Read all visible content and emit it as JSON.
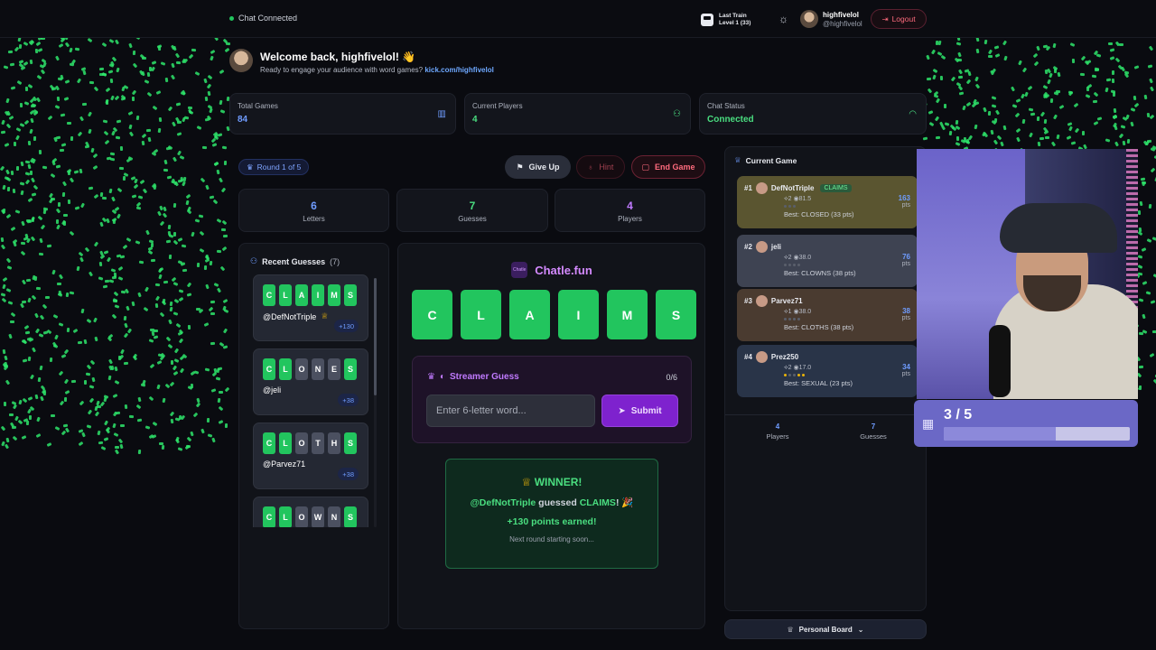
{
  "topbar": {
    "chat_status": "Chat Connected",
    "train_line1": "Last Train",
    "train_line2": "Level 1  (33)",
    "username": "highfivelol",
    "handle": "@highfivelol",
    "logout_label": "Logout"
  },
  "welcome": {
    "title": "Welcome back, highfivelol! 👋",
    "subtitle": "Ready to engage your audience with word games?",
    "link": "kick.com/highfivelol"
  },
  "stats": [
    {
      "label": "Total Games",
      "value": "84",
      "icon": "bar-chart-icon",
      "color": "#6f9cff"
    },
    {
      "label": "Current Players",
      "value": "4",
      "icon": "user-icon",
      "color": "#4ade80"
    },
    {
      "label": "Chat Status",
      "value": "Connected",
      "icon": "wifi-icon",
      "color": "#4ade80"
    }
  ],
  "game": {
    "round_label": "Round 1 of 5",
    "give_up_label": "Give Up",
    "hint_label": "Hint",
    "end_game_label": "End Game",
    "letters": {
      "value": "6",
      "label": "Letters"
    },
    "guesses": {
      "value": "7",
      "label": "Guesses"
    },
    "players": {
      "value": "4",
      "label": "Players"
    }
  },
  "recent_guesses": {
    "title": "Recent Guesses",
    "count": "(7)",
    "items": [
      {
        "letters": [
          "C",
          "L",
          "A",
          "I",
          "M",
          "S"
        ],
        "states": [
          "g",
          "g",
          "g",
          "g",
          "g",
          "g"
        ],
        "user": "@DefNotTriple",
        "trophy": true,
        "points": "+130"
      },
      {
        "letters": [
          "C",
          "L",
          "O",
          "N",
          "E",
          "S"
        ],
        "states": [
          "g",
          "g",
          "x",
          "x",
          "x",
          "g"
        ],
        "user": "@jeli",
        "trophy": false,
        "points": "+38"
      },
      {
        "letters": [
          "C",
          "L",
          "O",
          "T",
          "H",
          "S"
        ],
        "states": [
          "g",
          "g",
          "x",
          "x",
          "x",
          "g"
        ],
        "user": "@Parvez71",
        "trophy": false,
        "points": "+38"
      },
      {
        "letters": [
          "C",
          "L",
          "O",
          "W",
          "N",
          "S"
        ],
        "states": [
          "g",
          "g",
          "x",
          "x",
          "x",
          "g"
        ],
        "user": "",
        "trophy": false,
        "points": ""
      }
    ]
  },
  "board": {
    "logo_text": "Chatle",
    "brand": "Chatle.fun",
    "word": [
      "C",
      "L",
      "A",
      "I",
      "M",
      "S"
    ]
  },
  "streamer_guess": {
    "title": "Streamer Guess",
    "count": "0/6",
    "placeholder": "Enter 6-letter word...",
    "submit_label": "Submit"
  },
  "winner": {
    "title": "WINNER!",
    "user": "@DefNotTriple",
    "guessed_text": "guessed",
    "word": "CLAIMS",
    "suffix": "! 🎉",
    "points_text": "+130 points earned!",
    "next_text": "Next round starting soon..."
  },
  "current_game": {
    "title": "Current Game",
    "players": [
      {
        "rank": "#1",
        "name": "DefNotTriple",
        "badge": "CLAIMS",
        "sub": "⟡2 ◉81.5",
        "dots": [
          "g",
          "g",
          "g"
        ],
        "best": "Best: CLOSED (33 pts)",
        "points": "163",
        "pts_label": "pts",
        "bg": "#5a5530"
      },
      {
        "rank": "#2",
        "name": "jeli",
        "badge": "",
        "sub": "⟡2 ◉38.0",
        "dots": [
          "g",
          "g",
          "g",
          "g"
        ],
        "best": "Best: CLOWNS (38 pts)",
        "points": "76",
        "pts_label": "pts",
        "bg": "#3e4352"
      },
      {
        "rank": "#3",
        "name": "Parvez71",
        "badge": "",
        "sub": "⟡1 ◉38.0",
        "dots": [
          "g",
          "g",
          "g",
          "g"
        ],
        "best": "Best: CLOTHS (38 pts)",
        "points": "38",
        "pts_label": "pts",
        "bg": "#4a3b30"
      },
      {
        "rank": "#4",
        "name": "Prez250",
        "badge": "",
        "sub": "⟡2 ◉17.0",
        "dots": [
          "y",
          "g",
          "g",
          "y",
          "y"
        ],
        "best": "Best: SEXUAL (23 pts)",
        "points": "34",
        "pts_label": "pts",
        "bg": "#293448"
      }
    ],
    "footer": {
      "players_value": "4",
      "players_label": "Players",
      "guesses_value": "7",
      "guesses_label": "Guesses"
    }
  },
  "personal_board_label": "Personal Board",
  "sub_goal": {
    "value": "3 / 5",
    "progress": 0.6
  }
}
